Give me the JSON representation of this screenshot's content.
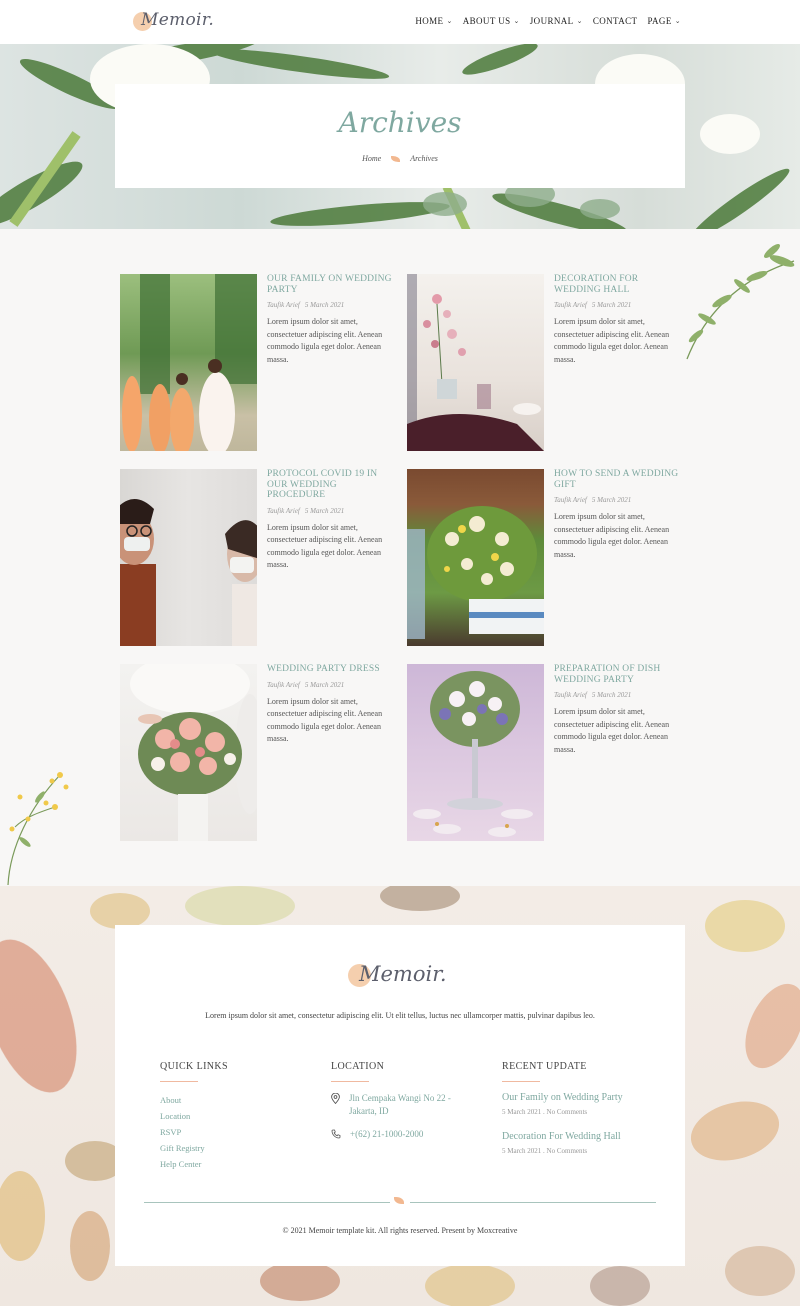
{
  "header": {
    "logo_text": "Memoir.",
    "nav": [
      {
        "label": "HOME",
        "has_dropdown": true
      },
      {
        "label": "ABOUT US",
        "has_dropdown": true
      },
      {
        "label": "JOURNAL",
        "has_dropdown": true
      },
      {
        "label": "CONTACT",
        "has_dropdown": false
      },
      {
        "label": "PAGE",
        "has_dropdown": true
      }
    ]
  },
  "hero": {
    "title": "Archives",
    "breadcrumb": [
      "Home",
      "Archives"
    ]
  },
  "posts": [
    {
      "title": "OUR FAMILY ON WEDDING PARTY",
      "author": "Taufik Arief",
      "date": "5 March 2021",
      "excerpt": "Lorem ipsum dolor sit amet, consectetuer adipiscing elit. Aenean commodo ligula eget dolor. Aenean massa.",
      "image": "bridesmaids-photo"
    },
    {
      "title": "DECORATION FOR WEDDING HALL",
      "author": "Taufik Arief",
      "date": "5 March 2021",
      "excerpt": "Lorem ipsum dolor sit amet, consectetuer adipiscing elit. Aenean commodo ligula eget dolor. Aenean massa.",
      "image": "wedding-hall-photo"
    },
    {
      "title": "PROTOCOL COVID 19 IN OUR WEDDING PROCEDURE",
      "author": "Taufik Arief",
      "date": "5 March 2021",
      "excerpt": "Lorem ipsum dolor sit amet, consectetuer adipiscing elit. Aenean commodo ligula eget dolor. Aenean massa.",
      "image": "masked-couple-photo"
    },
    {
      "title": "HOW TO SEND A WEDDING GIFT",
      "author": "Taufik Arief",
      "date": "5 March 2021",
      "excerpt": "Lorem ipsum dolor sit amet, consectetuer adipiscing elit. Aenean commodo ligula eget dolor. Aenean massa.",
      "image": "flower-vase-photo"
    },
    {
      "title": "WEDDING PARTY DRESS",
      "author": "Taufik Arief",
      "date": "5 March 2021",
      "excerpt": "Lorem ipsum dolor sit amet, consectetuer adipiscing elit. Aenean commodo ligula eget dolor. Aenean massa.",
      "image": "bouquet-photo"
    },
    {
      "title": "PREPARATION OF DISH WEDDING PARTY",
      "author": "Taufik Arief",
      "date": "5 March 2021",
      "excerpt": "Lorem ipsum dolor sit amet, consectetuer adipiscing elit. Aenean commodo ligula eget dolor. Aenean massa.",
      "image": "table-centerpiece-photo"
    }
  ],
  "footer": {
    "logo_text": "Memoir.",
    "description": "Lorem ipsum dolor sit amet, consectetur adipiscing elit. Ut elit tellus, luctus nec ullamcorper mattis, pulvinar dapibus leo.",
    "quick_links": {
      "heading": "QUICK LINKS",
      "items": [
        "About",
        "Location",
        "RSVP",
        "Gift Registry",
        "Help Center"
      ]
    },
    "location": {
      "heading": "LOCATION",
      "address": "Jln Cempaka Wangi No 22 - Jakarta, ID",
      "phone": "+(62) 21-1000-2000"
    },
    "recent_update": {
      "heading": "RECENT UPDATE",
      "items": [
        {
          "title": "Our Family on Wedding Party",
          "meta": "5 March 2021 . No Comments"
        },
        {
          "title": "Decoration For Wedding Hall",
          "meta": "5 March 2021 . No Comments"
        }
      ]
    },
    "copyright": "© 2021 Memoir template kit. All rights reserved. Present by Moxcreative"
  },
  "colors": {
    "accent": "#7fa8a0",
    "peach": "#f5cfae",
    "text": "#555555",
    "background": "#f8f7f6"
  }
}
